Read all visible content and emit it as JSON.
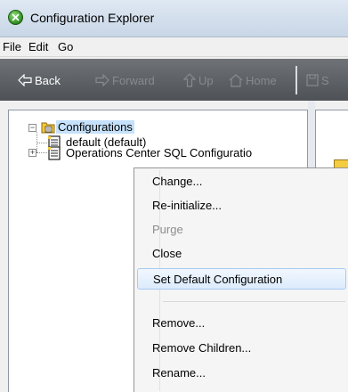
{
  "window": {
    "title": "Configuration Explorer"
  },
  "menubar": {
    "items": [
      "File",
      "Edit",
      "Go"
    ]
  },
  "toolbar": {
    "back": "Back",
    "forward": "Forward",
    "up": "Up",
    "home": "Home",
    "save_partial": "S"
  },
  "tree": {
    "root": "Configurations",
    "children": [
      {
        "label": "default (default)"
      },
      {
        "label": "Operations Center SQL Configuratio"
      }
    ]
  },
  "context_menu": {
    "items": [
      {
        "label": "Change..."
      },
      {
        "label": "Re-initialize..."
      },
      {
        "label": "Purge",
        "disabled": true
      },
      {
        "label": "Close"
      },
      {
        "label": "Set Default Configuration",
        "highlighted": true
      },
      {
        "label": "Remove..."
      },
      {
        "label": "Remove Children..."
      },
      {
        "label": "Rename..."
      }
    ]
  },
  "colors": {
    "toolbar_bg": "#5b5f63",
    "selection": "#c5e1fb",
    "menu_highlight": "#dcebfc"
  }
}
